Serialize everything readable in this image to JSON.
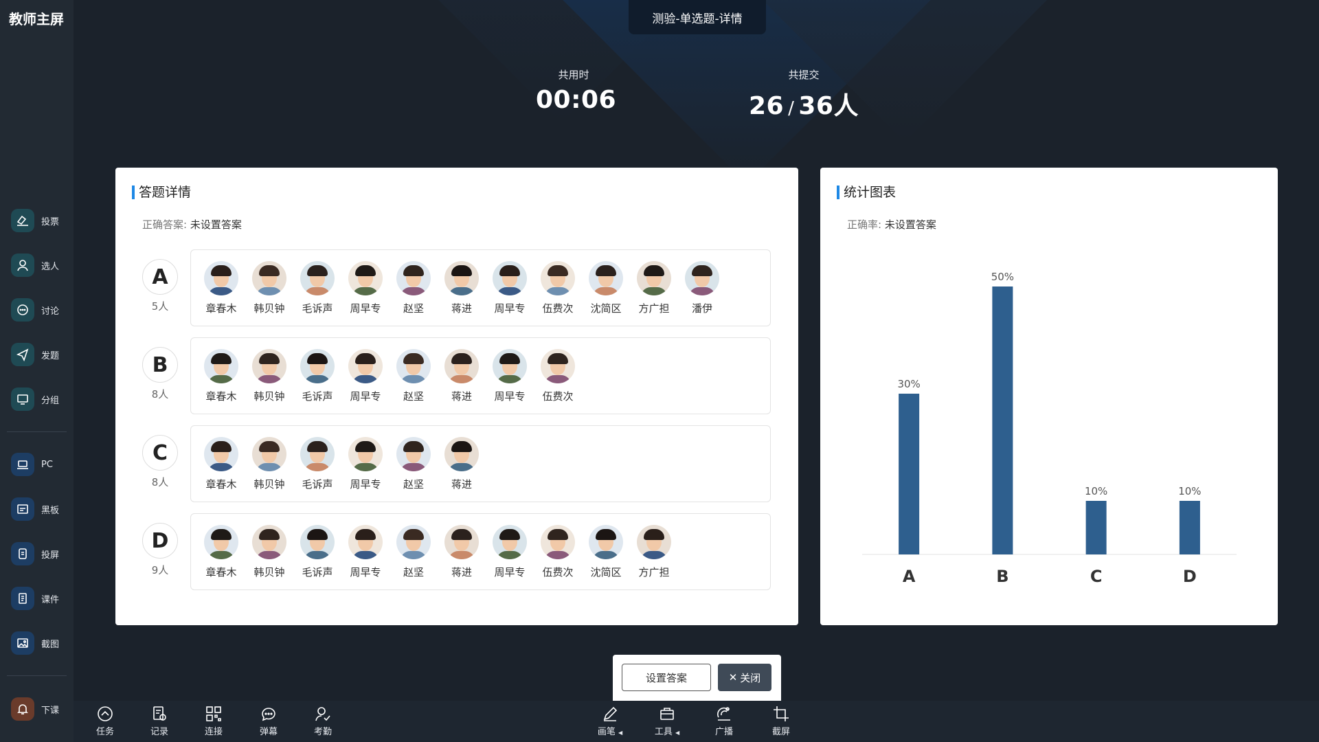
{
  "app_title": "教师主屏",
  "header": {
    "tab_title": "测验-单选题-详情",
    "time_label": "共用时",
    "time_value": "00:06",
    "submit_label": "共提交",
    "submit_done": "26",
    "submit_slash": "/",
    "submit_total": "36人"
  },
  "sidebar": {
    "items": [
      {
        "label": "投票",
        "icon": "vote-icon"
      },
      {
        "label": "选人",
        "icon": "person-icon"
      },
      {
        "label": "讨论",
        "icon": "chat-icon"
      },
      {
        "label": "发题",
        "icon": "send-icon"
      },
      {
        "label": "分组",
        "icon": "monitor-icon"
      },
      {
        "label": "PC",
        "icon": "laptop-icon"
      },
      {
        "label": "黑板",
        "icon": "board-icon"
      },
      {
        "label": "投屏",
        "icon": "phone-icon"
      },
      {
        "label": "课件",
        "icon": "document-icon"
      },
      {
        "label": "截图",
        "icon": "image-icon"
      },
      {
        "label": "下课",
        "icon": "bell-icon"
      }
    ]
  },
  "answers_panel": {
    "title": "答题详情",
    "correct_key": "正确答案:",
    "correct_value": "未设置答案",
    "options": [
      {
        "letter": "A",
        "count": "5人",
        "students": [
          "章春木",
          "韩贝钟",
          "毛诉声",
          "周早专",
          "赵坚",
          "蒋进",
          "周早专",
          "伍费次",
          "沈简区",
          "方广担",
          "潘伊"
        ]
      },
      {
        "letter": "B",
        "count": "8人",
        "students": [
          "章春木",
          "韩贝钟",
          "毛诉声",
          "周早专",
          "赵坚",
          "蒋进",
          "周早专",
          "伍费次"
        ]
      },
      {
        "letter": "C",
        "count": "8人",
        "students": [
          "章春木",
          "韩贝钟",
          "毛诉声",
          "周早专",
          "赵坚",
          "蒋进"
        ]
      },
      {
        "letter": "D",
        "count": "9人",
        "students": [
          "章春木",
          "韩贝钟",
          "毛诉声",
          "周早专",
          "赵坚",
          "蒋进",
          "周早专",
          "伍费次",
          "沈简区",
          "方广担"
        ]
      }
    ]
  },
  "chart_panel": {
    "title": "统计图表",
    "rate_key": "正确率:",
    "rate_value": "未设置答案"
  },
  "chart_data": {
    "type": "bar",
    "categories": [
      "A",
      "B",
      "C",
      "D"
    ],
    "values": [
      30,
      50,
      10,
      10
    ],
    "labels": [
      "30%",
      "50%",
      "10%",
      "10%"
    ],
    "ylim": [
      0,
      50
    ],
    "color": "#2e5f8e",
    "grid": false
  },
  "buttons": {
    "set_answer": "设置答案",
    "close": "关闭"
  },
  "bottom_tools_left": [
    {
      "label": "任务",
      "icon": "up-circle-icon"
    },
    {
      "label": "记录",
      "icon": "record-icon"
    },
    {
      "label": "连接",
      "icon": "qrcode-icon"
    },
    {
      "label": "弹幕",
      "icon": "bubble-icon"
    },
    {
      "label": "考勤",
      "icon": "attendance-icon"
    }
  ],
  "bottom_tools_right": [
    {
      "label": "画笔",
      "icon": "pen-icon"
    },
    {
      "label": "工具",
      "icon": "toolbox-icon"
    },
    {
      "label": "广播",
      "icon": "broadcast-icon"
    },
    {
      "label": "截屏",
      "icon": "crop-icon"
    }
  ]
}
